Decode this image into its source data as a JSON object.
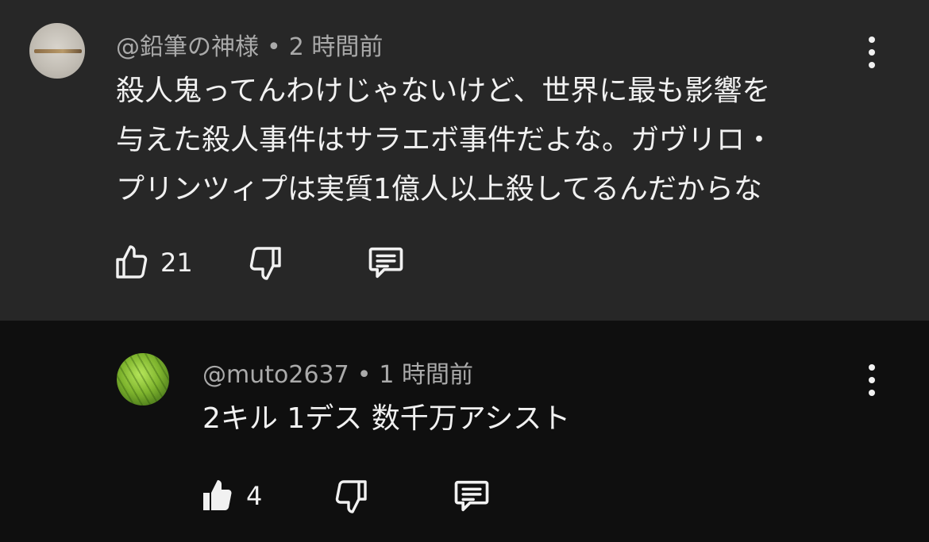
{
  "comments": [
    {
      "username": "@鉛筆の神様",
      "separator": "•",
      "time": "2 時間前",
      "text_lines": [
        "殺人鬼ってんわけじゃないけど、世界に最も影響を",
        "与えた殺人事件はサラエボ事件だよな。ガヴリロ・",
        "プリンツィプは実質1億人以上殺してるんだからな"
      ],
      "like_count": "21",
      "like_icon": "thumbs-up-outline-icon",
      "dislike_icon": "thumbs-down-outline-icon",
      "reply_icon": "comment-icon",
      "menu_icon": "more-vertical-icon"
    },
    {
      "username": "@muto2637",
      "separator": "•",
      "time": "1 時間前",
      "text_lines": [
        "2キル 1デス 数千万アシスト"
      ],
      "like_count": "4",
      "like_icon": "thumbs-up-filled-icon",
      "dislike_icon": "thumbs-down-outline-icon",
      "reply_icon": "comment-icon",
      "menu_icon": "more-vertical-icon"
    }
  ],
  "colors": {
    "top_background": "#272727",
    "reply_background": "#0f0f0f",
    "text": "#f1f1f1",
    "meta_text": "#aaaaaa"
  }
}
